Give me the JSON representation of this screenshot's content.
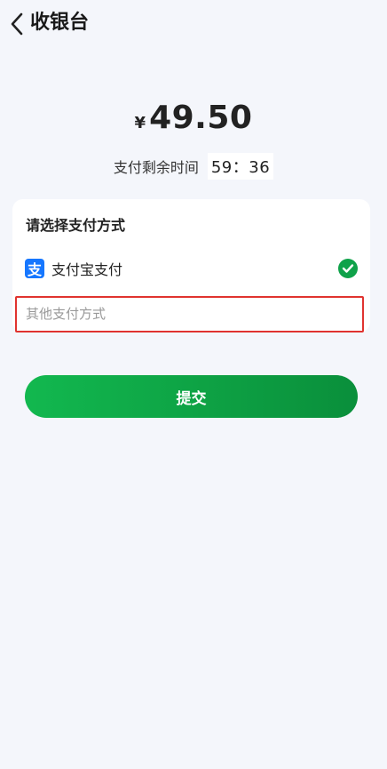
{
  "header": {
    "title": "收银台"
  },
  "payment": {
    "currency_symbol": "¥",
    "amount": "49.50",
    "timer_label": "支付剩余时间",
    "timer_value": "59：36"
  },
  "methods": {
    "title": "请选择支付方式",
    "alipay_icon_glyph": "支",
    "alipay_label": "支付宝支付",
    "other_label": "其他支付方式"
  },
  "actions": {
    "submit_label": "提交"
  },
  "colors": {
    "accent_green": "#0fa24a",
    "alipay_blue": "#1677ff",
    "highlight_red": "#e0332f",
    "background": "#f4f6fb"
  },
  "icons": {
    "back": "chevron-left-icon",
    "alipay": "alipay-icon",
    "selected": "check-circle-icon"
  }
}
